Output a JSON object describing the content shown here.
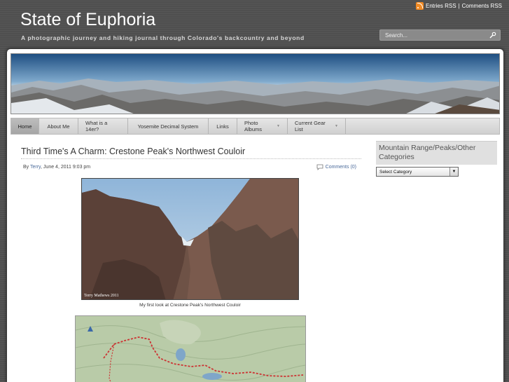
{
  "header": {
    "title": "State of Euphoria",
    "description": "A photographic journey and hiking journal through Colorado's backcountry and beyond",
    "rss_entries": "Entries RSS",
    "rss_separator": "|",
    "rss_comments": "Comments RSS",
    "search_placeholder": "Search..."
  },
  "nav": {
    "items": [
      {
        "label": "Home",
        "active": true,
        "has_dropdown": false
      },
      {
        "label": "About Me",
        "active": false,
        "has_dropdown": false
      },
      {
        "label": "What is a 14er?",
        "active": false,
        "has_dropdown": false
      },
      {
        "label": "Yosemite Decimal System",
        "active": false,
        "has_dropdown": false
      },
      {
        "label": "Links",
        "active": false,
        "has_dropdown": false
      },
      {
        "label": "Photo Albums",
        "active": false,
        "has_dropdown": true
      },
      {
        "label": "Current Gear List",
        "active": false,
        "has_dropdown": true
      }
    ],
    "dropdown_glyph": "▼"
  },
  "post": {
    "title": "Third Time's A Charm: Crestone Peak's Northwest Couloir",
    "by_label": "By",
    "author": "Terry",
    "date": ", June 4, 2011 9:03 pm",
    "comments": "Comments (0)",
    "photo1_watermark": "Terry Mathews 2011",
    "photo1_caption": "My first look at Crestone Peak's Northwest Couloir"
  },
  "sidebar": {
    "category_title": "Mountain Range/Peaks/Other Categories",
    "category_select": "Select Category"
  },
  "colors": {
    "background": "#525252",
    "link": "#4a6a9a",
    "rss": "#f08a24",
    "nav_active": "#b0b0b0"
  }
}
